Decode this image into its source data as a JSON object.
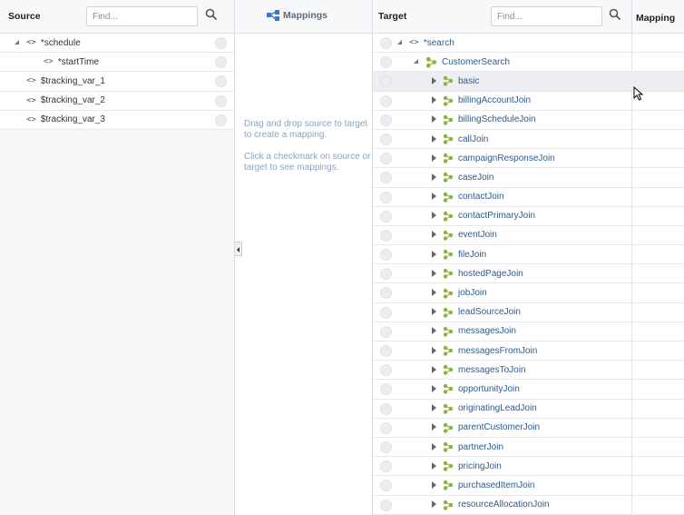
{
  "source": {
    "title": "Source",
    "find_placeholder": "Find...",
    "items": [
      {
        "label": "*schedule",
        "expander": "open",
        "indent": 0
      },
      {
        "label": "*startTime",
        "expander": "none",
        "indent": 1
      },
      {
        "label": "$tracking_var_1",
        "expander": "none",
        "indent": 0
      },
      {
        "label": "$tracking_var_2",
        "expander": "none",
        "indent": 0
      },
      {
        "label": "$tracking_var_3",
        "expander": "none",
        "indent": 0
      }
    ]
  },
  "mappings": {
    "title": "Mappings",
    "help_1": "Drag and drop source to target to create a mapping.",
    "help_2": "Click a checkmark on source or target to see mappings."
  },
  "target": {
    "title": "Target",
    "find_placeholder": "Find...",
    "mapping_column": "Mapping",
    "root": "*search",
    "group": "CustomerSearch",
    "items": [
      "basic",
      "billingAccountJoin",
      "billingScheduleJoin",
      "callJoin",
      "campaignResponseJoin",
      "caseJoin",
      "contactJoin",
      "contactPrimaryJoin",
      "eventJoin",
      "fileJoin",
      "hostedPageJoin",
      "jobJoin",
      "leadSourceJoin",
      "messagesJoin",
      "messagesFromJoin",
      "messagesToJoin",
      "opportunityJoin",
      "originatingLeadJoin",
      "parentCustomerJoin",
      "partnerJoin",
      "pricingJoin",
      "purchasedItemJoin",
      "resourceAllocationJoin"
    ],
    "selected_index": 0
  },
  "icons": {
    "search": "search-icon",
    "element": "element-icon",
    "join": "complex-element-icon",
    "mappings": "mappings-icon"
  },
  "colors": {
    "label_blue": "#2d5b8c",
    "icon_green": "#8bb33c",
    "help_text": "#8da3ba"
  }
}
